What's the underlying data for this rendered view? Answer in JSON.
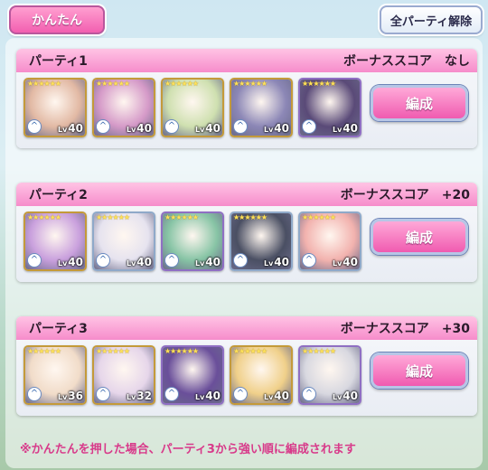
{
  "header": {
    "easy_label": "かんたん",
    "clear_all_label": "全パーティ解除"
  },
  "parties": [
    {
      "name": "パーティ1",
      "bonus": "ボーナススコア　なし",
      "edit_label": "編成",
      "members": [
        {
          "level": "40",
          "level_prefix": "Lv",
          "frame": "gold",
          "color": "#e2b9a4"
        },
        {
          "level": "40",
          "level_prefix": "Lv",
          "frame": "gold",
          "color": "#d59ac8"
        },
        {
          "level": "40",
          "level_prefix": "Lv",
          "frame": "gold",
          "color": "#cfe0b0"
        },
        {
          "level": "40",
          "level_prefix": "Lv",
          "frame": "gold",
          "color": "#8c87b6"
        },
        {
          "level": "40",
          "level_prefix": "Lv",
          "frame": "purple",
          "color": "#5a4a78"
        }
      ]
    },
    {
      "name": "パーティ2",
      "bonus": "ボーナススコア　+20",
      "edit_label": "編成",
      "members": [
        {
          "level": "40",
          "level_prefix": "Lv",
          "frame": "gold",
          "color": "#c9a0dd"
        },
        {
          "level": "40",
          "level_prefix": "Lv",
          "frame": "silver",
          "color": "#e6e3ef"
        },
        {
          "level": "40",
          "level_prefix": "Lv",
          "frame": "purple",
          "color": "#87c4a5"
        },
        {
          "level": "40",
          "level_prefix": "Lv",
          "frame": "silver",
          "color": "#4a4f63"
        },
        {
          "level": "40",
          "level_prefix": "Lv",
          "frame": "silver",
          "color": "#f2b2ae"
        }
      ]
    },
    {
      "name": "パーティ3",
      "bonus": "ボーナススコア　+30",
      "edit_label": "編成",
      "members": [
        {
          "level": "36",
          "level_prefix": "Lv",
          "frame": "gold",
          "color": "#f1dcc9"
        },
        {
          "level": "32",
          "level_prefix": "Lv",
          "frame": "gold",
          "color": "#e6d6ea"
        },
        {
          "level": "40",
          "level_prefix": "Lv",
          "frame": "purple",
          "color": "#6a4f9a"
        },
        {
          "level": "40",
          "level_prefix": "Lv",
          "frame": "gold",
          "color": "#f0d08a"
        },
        {
          "level": "40",
          "level_prefix": "Lv",
          "frame": "purple",
          "color": "#d8d8e0"
        }
      ]
    }
  ],
  "footer_note": "※かんたんを押した場合、パーティ3から強い順に編成されます"
}
